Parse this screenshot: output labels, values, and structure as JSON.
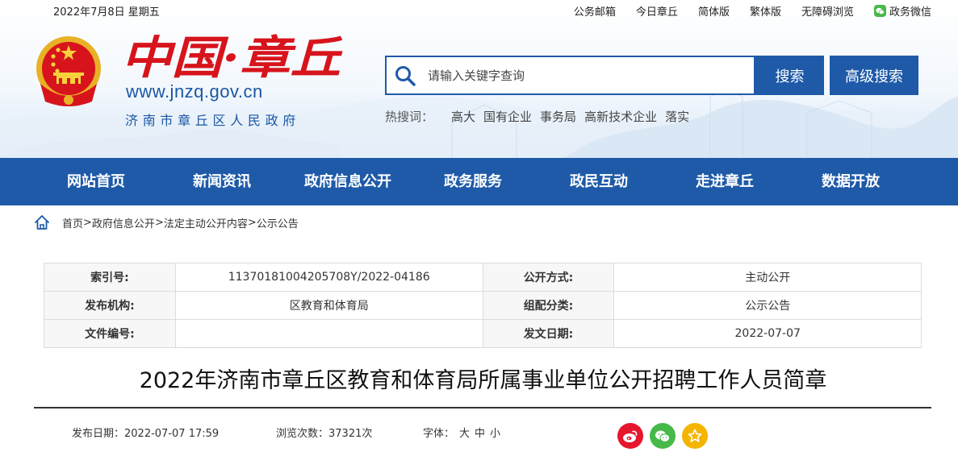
{
  "topbar": {
    "date": "2022年7月8日  星期五",
    "links": [
      "公务邮箱",
      "今日章丘",
      "简体版",
      "繁体版",
      "无障碍浏览",
      "政务微信"
    ]
  },
  "brand": {
    "title": "中国·章丘",
    "url": "www.jnzq.gov.cn",
    "subtitle": "济南市章丘区人民政府"
  },
  "search": {
    "placeholder": "请输入关键字查询",
    "button": "搜索",
    "advanced_button": "高级搜索",
    "hot_label": "热搜词：",
    "hot_words": [
      "高大",
      "国有企业",
      "事务局",
      "高新技术企业",
      "落实"
    ]
  },
  "nav": [
    "网站首页",
    "新闻资讯",
    "政府信息公开",
    "政务服务",
    "政民互动",
    "走进章丘",
    "数据开放"
  ],
  "breadcrumb": [
    "首页",
    "政府信息公开",
    "法定主动公开内容",
    "公示公告"
  ],
  "info_table": {
    "rows": [
      {
        "k1": "索引号:",
        "v1": "11370181004205708Y/2022-04186",
        "k2": "公开方式:",
        "v2": "主动公开"
      },
      {
        "k1": "发布机构:",
        "v1": "区教育和体育局",
        "k2": "组配分类:",
        "v2": "公示公告"
      },
      {
        "k1": "文件编号:",
        "v1": "",
        "k2": "发文日期:",
        "v2": "2022-07-07"
      }
    ]
  },
  "article": {
    "title": "2022年济南市章丘区教育和体育局所属事业单位公开招聘工作人员简章",
    "publish_label": "发布日期：",
    "publish_date": "2022-07-07 17:59",
    "views_label": "浏览次数：",
    "views": "37321次",
    "font_label": "字体：",
    "font_options": [
      "大",
      "中",
      "小"
    ]
  },
  "share_icons": [
    "weibo-icon",
    "wechat-icon",
    "favorite-icon"
  ],
  "colors": {
    "brand_blue": "#1e5aa8",
    "title_red": "#d7141c",
    "weibo_red": "#e6162d",
    "wechat_green": "#46b949",
    "fav_gold": "#f4b400"
  }
}
